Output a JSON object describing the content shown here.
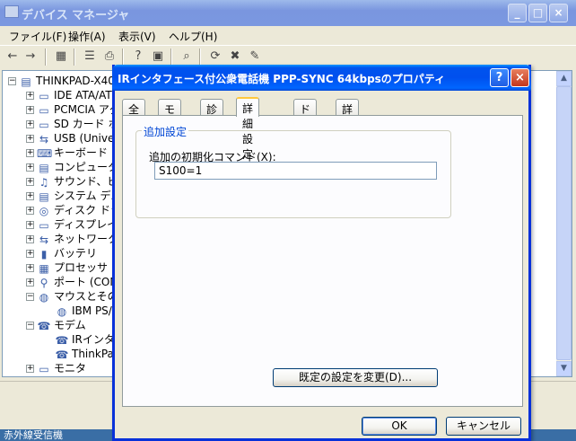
{
  "main_window": {
    "title": "デバイス マネージャ",
    "minimize_glyph": "_",
    "maximize_glyph": "□",
    "close_glyph": "×"
  },
  "menu": [
    "ファイル(F)",
    "操作(A)",
    "表示(V)",
    "ヘルプ(H)"
  ],
  "toolbar": {
    "back_glyph": "←",
    "forward_glyph": "→",
    "icons": [
      "▦",
      "☰",
      "⎙",
      "?",
      "▣",
      "⌕",
      "⟳",
      "✖",
      "✎"
    ]
  },
  "tree": [
    {
      "expander": "−",
      "icon": "▤",
      "label": "THINKPAD-X40"
    },
    {
      "expander": "+",
      "icon": "▭",
      "label": "IDE ATA/AT"
    },
    {
      "expander": "+",
      "icon": "▭",
      "label": "PCMCIA アダ"
    },
    {
      "expander": "+",
      "icon": "▭",
      "label": "SD カード ホ"
    },
    {
      "expander": "+",
      "icon": "⇆",
      "label": "USB (Univer"
    },
    {
      "expander": "+",
      "icon": "⌨",
      "label": "キーボード"
    },
    {
      "expander": "+",
      "icon": "▤",
      "label": "コンピュータ"
    },
    {
      "expander": "+",
      "icon": "♫",
      "label": "サウンド、ビデ"
    },
    {
      "expander": "+",
      "icon": "▤",
      "label": "システム デバ"
    },
    {
      "expander": "+",
      "icon": "◎",
      "label": "ディスク ドライ"
    },
    {
      "expander": "+",
      "icon": "▭",
      "label": "ディスプレイ ア"
    },
    {
      "expander": "+",
      "icon": "⇆",
      "label": "ネットワーク ア"
    },
    {
      "expander": "+",
      "icon": "▮",
      "label": "バッテリ"
    },
    {
      "expander": "+",
      "icon": "▦",
      "label": "プロセッサ"
    },
    {
      "expander": "+",
      "icon": "⚲",
      "label": "ポート (COM"
    },
    {
      "expander": "−",
      "icon": "◍",
      "label": "マウスとそのほ"
    },
    {
      "expander": "",
      "icon": "◍",
      "label": "IBM PS/"
    },
    {
      "expander": "−",
      "icon": "☎",
      "label": "モデム"
    },
    {
      "expander": "",
      "icon": "☎",
      "label": "IRインタフェ"
    },
    {
      "expander": "",
      "icon": "☎",
      "label": "ThinkPad"
    },
    {
      "expander": "+",
      "icon": "▭",
      "label": "モニタ"
    }
  ],
  "scrollbar": {
    "up_glyph": "▲",
    "down_glyph": "▼"
  },
  "taskbar_text": "赤外線受信機",
  "dialog": {
    "title": "IRインタフェース付公衆電話機 PPP-SYNC 64kbpsのプロパティ",
    "help_glyph": "?",
    "close_glyph": "×",
    "tabs": [
      "全般",
      "モデム",
      "診断",
      "詳細設定",
      "ドライバ",
      "詳細"
    ],
    "active_tab": "詳細設定",
    "group_caption": "追加設定",
    "init_command_label": "追加の初期化コマンド(X):",
    "init_command_value": "S100=1",
    "change_defaults_button": "既定の設定を変更(D)...",
    "ok_button": "OK",
    "cancel_button": "キャンセル"
  }
}
